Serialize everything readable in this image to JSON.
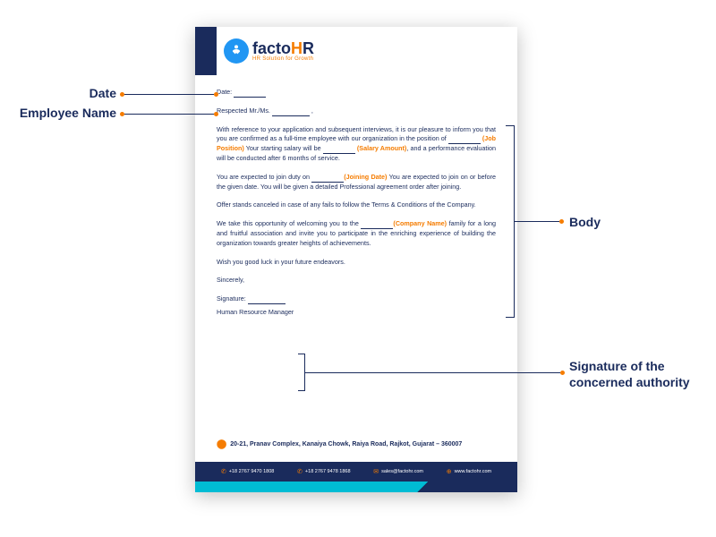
{
  "logo": {
    "text1": "facto",
    "text2": "H",
    "text3": "R",
    "tagline": "HR Solution for Growth"
  },
  "letter": {
    "dateLabel": "Date:",
    "salutation": "Respected Mr./Ms.",
    "salutationEnd": ",",
    "p1a": "With reference to your application and subsequent interviews, it is our pleasure to inform you that you are confirmed as a full-time employee with our organization in the position of ",
    "p1fill1": "(Job Position)",
    "p1b": " Your starting salary will be ",
    "p1fill2": "(Salary Amount)",
    "p1c": ", and a performance evaluation will be conducted after 6 months of service.",
    "p2a": "You are expected to join duty on ",
    "p2fill": "(Joining Date)",
    "p2b": " You are expected to join on or before the given date. You will be given a detailed Professional agreement order after joining.",
    "p3": "Offer stands canceled in case of any fails to follow the Terms & Conditions of the Company.",
    "p4a": "We take this opportunity of welcoming you to the ",
    "p4fill": "(Company Name)",
    "p4b": " family for a long and fruitful association and invite you to participate in the enriching experience of building the organization towards greater heights of achievements.",
    "p5": "Wish you good luck in your future endeavors.",
    "closing": "Sincerely,",
    "sigLabel": "Signature:",
    "sigTitle": "Human Resource Manager"
  },
  "address": "20-21, Pranav Complex, Kanaiya Chowk, Raiya Road, Rajkot, Gujarat – 360007",
  "footer": {
    "phone1": "+18 2767 9470 1808",
    "phone2": "+18 2767 9478 1868",
    "email": "sales@factohr.com",
    "web": "www.factohr.com"
  },
  "annotations": {
    "date": "Date",
    "empName": "Employee Name",
    "body": "Body",
    "signature": "Signature of the concerned authority"
  }
}
